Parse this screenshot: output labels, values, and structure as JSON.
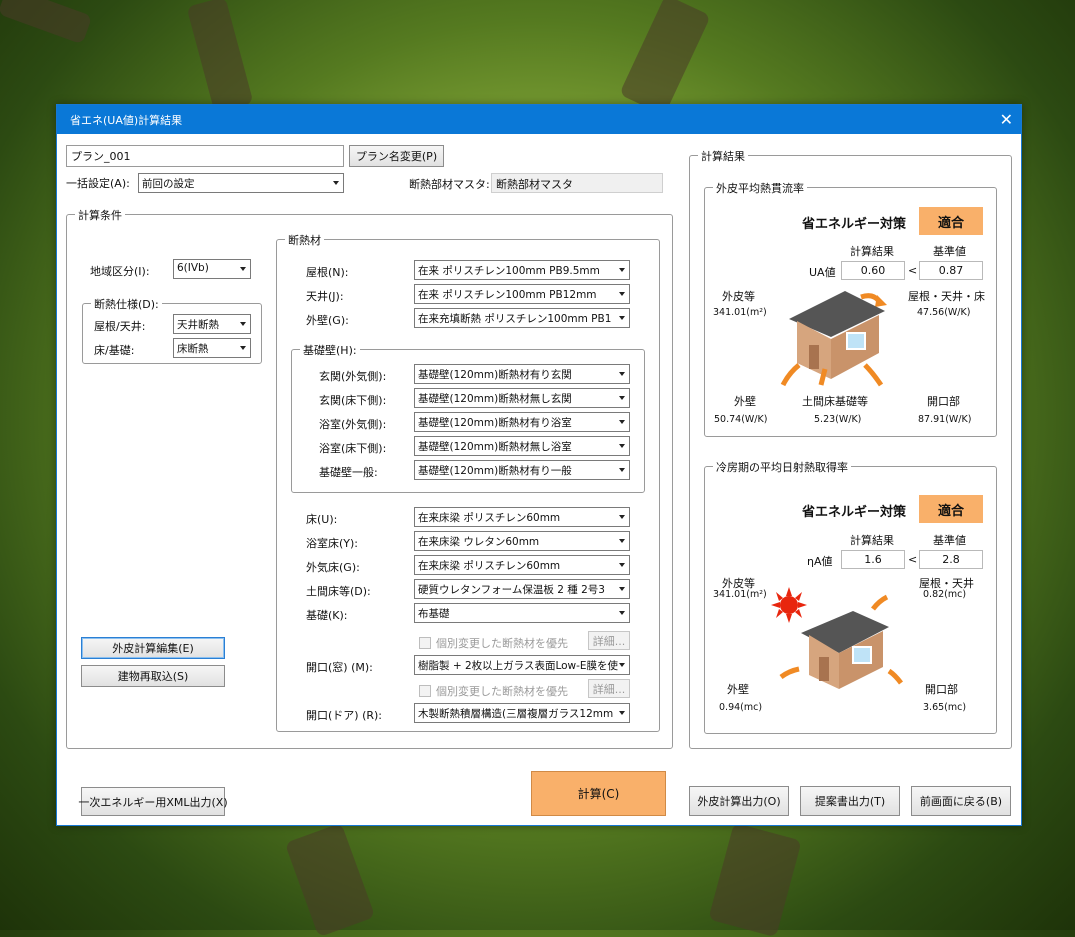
{
  "window": {
    "title": "省エネ(UA値)計算結果"
  },
  "plan": {
    "name": "プラン_001",
    "rename_label": "プラン名変更(P)"
  },
  "bulk": {
    "label": "一括設定(A):",
    "value": "前回の設定"
  },
  "master": {
    "label": "断熱部材マスタ:",
    "value": "断熱部材マスタ"
  },
  "conditions": {
    "legend": "計算条件",
    "region_label": "地域区分(I):",
    "region_value": "6(IVb)",
    "spec": {
      "legend": "断熱仕様(D):",
      "roof_label": "屋根/天井:",
      "roof_value": "天井断熱",
      "floor_label": "床/基礎:",
      "floor_value": "床断熱"
    },
    "btn_envelope_edit": "外皮計算編集(E)",
    "btn_reload": "建物再取込(S)"
  },
  "insulation": {
    "legend": "断熱材",
    "roof_label": "屋根(N):",
    "roof_value": "在来 ポリスチレン100mm PB9.5mm",
    "ceiling_label": "天井(J):",
    "ceiling_value": "在来 ポリスチレン100mm PB12mm",
    "wall_label": "外壁(G):",
    "wall_value": "在来充填断熱 ポリスチレン100mm PB1",
    "foundation": {
      "legend": "基礎壁(H):",
      "rows": [
        {
          "label": "玄関(外気側):",
          "value": "基礎壁(120mm)断熱材有り玄関"
        },
        {
          "label": "玄関(床下側):",
          "value": "基礎壁(120mm)断熱材無し玄関"
        },
        {
          "label": "浴室(外気側):",
          "value": "基礎壁(120mm)断熱材有り浴室"
        },
        {
          "label": "浴室(床下側):",
          "value": "基礎壁(120mm)断熱材無し浴室"
        },
        {
          "label": "基礎壁一般:",
          "value": "基礎壁(120mm)断熱材有り一般"
        }
      ]
    },
    "floor_label": "床(U):",
    "floor_value": "在来床梁 ポリスチレン60mm",
    "bath_floor_label": "浴室床(Y):",
    "bath_floor_value": "在来床梁 ウレタン60mm",
    "outer_floor_label": "外気床(G):",
    "outer_floor_value": "在来床梁 ポリスチレン60mm",
    "earth_floor_label": "土間床等(D):",
    "earth_floor_value": "硬質ウレタンフォーム保温板 2 種 2号3",
    "base_label": "基礎(K):",
    "base_value": "布基礎",
    "priority_label": "個別変更した断熱材を優先",
    "detail_label": "詳細...",
    "window_label": "開口(窓) (M):",
    "window_value": "樹脂製 + 2枚以上ガラス表面Low-E膜を使",
    "door_label": "開口(ドア) (R):",
    "door_value": "木製断熱積層構造(三層複層ガラス12mm"
  },
  "results": {
    "legend": "計算結果",
    "ua": {
      "legend": "外皮平均熱貫流率",
      "title": "省エネルギー対策",
      "badge": "適合",
      "col_result": "計算結果",
      "col_standard": "基準値",
      "row_label": "UA値",
      "result_value": "0.60",
      "lt": "<",
      "standard_value": "0.87",
      "envelope_label": "外皮等",
      "envelope_value": "341.01(m²)",
      "roof_label": "屋根・天井・床",
      "roof_value": "47.56(W/K)",
      "wall_label": "外壁",
      "wall_value": "50.74(W/K)",
      "earth_label": "土間床基礎等",
      "earth_value": "5.23(W/K)",
      "opening_label": "開口部",
      "opening_value": "87.91(W/K)"
    },
    "eta": {
      "legend": "冷房期の平均日射熱取得率",
      "title": "省エネルギー対策",
      "badge": "適合",
      "col_result": "計算結果",
      "col_standard": "基準値",
      "row_label": "ηA値",
      "result_value": "1.6",
      "lt": "<",
      "standard_value": "2.8",
      "envelope_label": "外皮等",
      "envelope_value": "341.01(m²)",
      "roof_label": "屋根・天井",
      "roof_value": "0.82(mc)",
      "wall_label": "外壁",
      "wall_value": "0.94(mc)",
      "opening_label": "開口部",
      "opening_value": "3.65(mc)"
    }
  },
  "footer": {
    "xml_btn": "一次エネルギー用XML出力(X)",
    "calc_btn": "計算(C)",
    "env_out_btn": "外皮計算出力(O)",
    "proposal_btn": "提案書出力(T)",
    "back_btn": "前画面に戻る(B)"
  },
  "colors": {
    "accent": "#0a78d7",
    "badge": "#f9b06a",
    "arrow": "#f08a24",
    "roof": "#555555",
    "house": "#d6a57e"
  }
}
